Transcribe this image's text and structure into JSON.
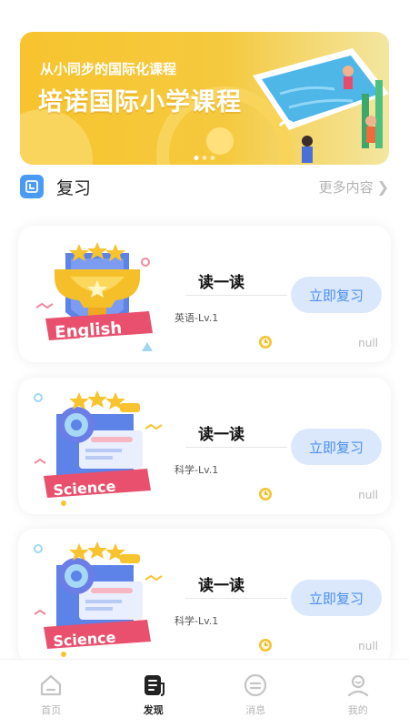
{
  "banner": {
    "subtitle": "从小同步的国际化课程",
    "title": "培诺国际小学课程"
  },
  "section": {
    "title": "复习",
    "more_label": "更多内容",
    "more_chevron": "❯"
  },
  "cards": [
    {
      "subject_badge": "English",
      "title": "读一读",
      "level": "英语-Lv.1",
      "button": "立即复习",
      "footer": "null"
    },
    {
      "subject_badge": "Science",
      "title": "读一读",
      "level": "科学-Lv.1",
      "button": "立即复习",
      "footer": "null"
    },
    {
      "subject_badge": "Science",
      "title": "读一读",
      "level": "科学-Lv.1",
      "button": "立即复习",
      "footer": "null"
    }
  ],
  "tabbar": {
    "items": [
      {
        "label": "首页",
        "icon": "home-icon"
      },
      {
        "label": "发现",
        "icon": "discover-icon",
        "active": true
      },
      {
        "label": "消息",
        "icon": "message-icon"
      },
      {
        "label": "我的",
        "icon": "profile-icon"
      }
    ]
  },
  "colors": {
    "accent": "#4a9bf6",
    "button_bg": "#dbe8fb",
    "button_text": "#4a8ef0",
    "banner_yellow": "#f7c42f",
    "badge_pink": "#e8506e"
  }
}
